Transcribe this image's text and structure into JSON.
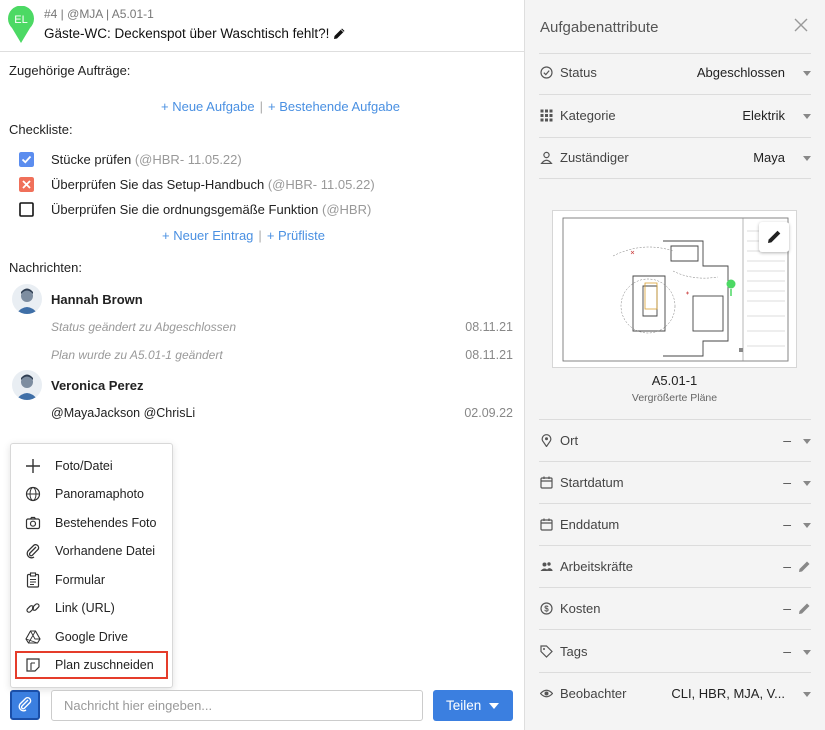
{
  "header": {
    "avatar_initials": "EL",
    "meta": "#4 | @MJA | A5.01-1",
    "title": "Gäste-WC: Deckenspot über Waschtisch fehlt?!"
  },
  "related": {
    "heading": "Zugehörige Aufträge:",
    "new_task": "+ Neue Aufgabe",
    "separator": "|",
    "existing_task": "+ Bestehende Aufgabe"
  },
  "checklist": {
    "heading": "Checkliste:",
    "items": [
      {
        "label": "Stücke prüfen",
        "meta": "(@HBR- 11.05.22)",
        "state": "checked"
      },
      {
        "label": "Überprüfen Sie das Setup-Handbuch",
        "meta": "(@HBR- 11.05.22)",
        "state": "failed"
      },
      {
        "label": "Überprüfen Sie die ordnungsgemäße Funktion",
        "meta": "(@HBR)",
        "state": "empty"
      }
    ],
    "new_entry": "+ Neuer Eintrag",
    "separator": "|",
    "checklist_link": "+ Prüfliste"
  },
  "messages": {
    "heading": "Nachrichten:",
    "threads": [
      {
        "author": "Hannah Brown",
        "lines": [
          {
            "text": "Status geändert zu Abgeschlossen",
            "date": "08.11.21"
          },
          {
            "text": "Plan wurde zu A5.01-1 geändert",
            "date": "08.11.21"
          }
        ]
      },
      {
        "author": "Veronica Perez",
        "lines": [
          {
            "text": "@MayaJackson  @ChrisLi",
            "date": "02.09.22"
          }
        ]
      }
    ]
  },
  "attach_menu": {
    "items": [
      {
        "label": "Foto/Datei",
        "icon": "plus-icon"
      },
      {
        "label": "Panoramaphoto",
        "icon": "globe-icon"
      },
      {
        "label": "Bestehendes Foto",
        "icon": "camera-icon"
      },
      {
        "label": "Vorhandene Datei",
        "icon": "paperclip-icon"
      },
      {
        "label": "Formular",
        "icon": "clipboard-icon"
      },
      {
        "label": "Link (URL)",
        "icon": "link-icon"
      },
      {
        "label": "Google Drive",
        "icon": "google-drive-icon"
      },
      {
        "label": "Plan zuschneiden",
        "icon": "crop-plan-icon",
        "highlighted": true
      }
    ]
  },
  "composer": {
    "placeholder": "Nachricht hier eingeben...",
    "share_label": "Teilen"
  },
  "panel": {
    "title": "Aufgabenattribute",
    "status": {
      "label": "Status",
      "value": "Abgeschlossen"
    },
    "category": {
      "label": "Kategorie",
      "value": "Elektrik"
    },
    "assignee": {
      "label": "Zuständiger",
      "value": "Maya"
    },
    "plan": {
      "name": "A5.01-1",
      "subtitle": "Vergrößerte Pläne"
    },
    "location": {
      "label": "Ort",
      "value": "–"
    },
    "start_date": {
      "label": "Startdatum",
      "value": "–"
    },
    "end_date": {
      "label": "Enddatum",
      "value": "–"
    },
    "workers": {
      "label": "Arbeitskräfte",
      "value": "–"
    },
    "costs": {
      "label": "Kosten",
      "value": "–"
    },
    "tags": {
      "label": "Tags",
      "value": "–"
    },
    "watchers": {
      "label": "Beobachter",
      "value": "CLI, HBR, MJA, V..."
    }
  },
  "colors": {
    "accent": "#3b7fe0",
    "link": "#4a90e2",
    "pin": "#4cd964",
    "checked": "#5b8def",
    "failed": "#f0705a",
    "highlight": "#e53c2a"
  }
}
